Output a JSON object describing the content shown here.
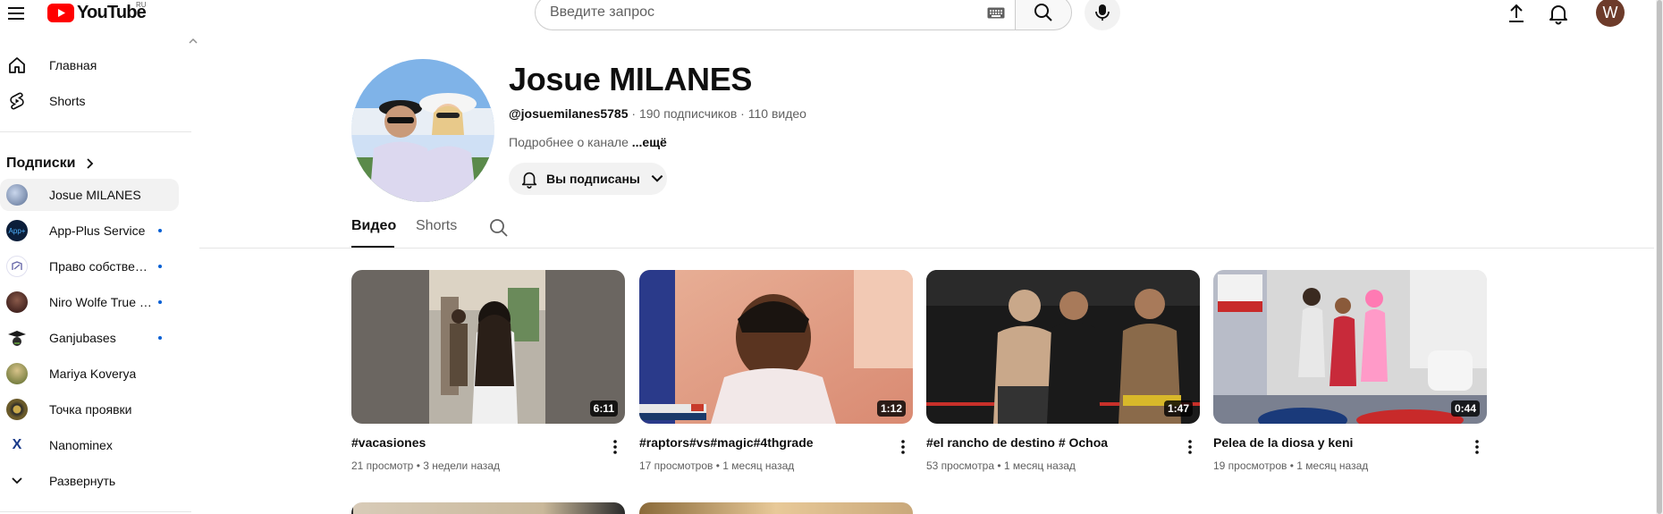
{
  "header": {
    "logo_text": "YouTube",
    "logo_region": "RU",
    "search_placeholder": "Введите запрос",
    "avatar_letter": "W"
  },
  "sidebar": {
    "main": [
      {
        "label": "Главная",
        "icon": "home-icon"
      },
      {
        "label": "Shorts",
        "icon": "shorts-icon"
      }
    ],
    "subscriptions_heading": "Подписки",
    "subscriptions": [
      {
        "label": "Josue MILANES",
        "active": true,
        "dot": false,
        "color": "#7a8fb3"
      },
      {
        "label": "App-Plus Service",
        "active": false,
        "dot": true,
        "color": "#0b1e3a",
        "mark": "App+"
      },
      {
        "label": "Право собственн…",
        "active": false,
        "dot": true,
        "color": "#e8e8f5"
      },
      {
        "label": "Niro Wolfe True …",
        "active": false,
        "dot": true,
        "color": "#5a2a2a"
      },
      {
        "label": "Ganjubases",
        "active": false,
        "dot": true,
        "color": "#1a1a1a"
      },
      {
        "label": "Mariya Koverya",
        "active": false,
        "dot": false,
        "color": "#8a7a3a"
      },
      {
        "label": "Точка проявки",
        "active": false,
        "dot": false,
        "color": "#5a4a20"
      },
      {
        "label": "Nanominex",
        "active": false,
        "dot": false,
        "color": "#ffffff",
        "mark": "X"
      }
    ],
    "expand_label": "Развернуть"
  },
  "channel": {
    "name": "Josue MILANES",
    "handle": "@josuemilanes5785",
    "subscribers": "190 подписчиков",
    "videos_count": "110 видео",
    "separator": " · ",
    "description": "Подробнее о канале",
    "more": "...ещё",
    "subscribed_label": "Вы подписаны"
  },
  "tabs": [
    {
      "label": "Видео",
      "active": true
    },
    {
      "label": "Shorts",
      "active": false
    }
  ],
  "videos": [
    {
      "title": "#vacasiones",
      "views": "21 просмотр",
      "age": "3 недели назад",
      "duration": "6:11"
    },
    {
      "title": "#raptors#vs#magic#4thgrade",
      "views": "17 просмотров",
      "age": "1 месяц назад",
      "duration": "1:12"
    },
    {
      "title": "#el rancho de destino # Ochoa",
      "views": "53 просмотра",
      "age": "1 месяц назад",
      "duration": "1:47"
    },
    {
      "title": "Pelea de la diosa y keni",
      "views": "19 просмотров",
      "age": "1 месяц назад",
      "duration": "0:44"
    }
  ],
  "meta_separator": " • ",
  "colors": {
    "brand_red": "#ff0000",
    "subscription_dot": "#065fd4"
  }
}
